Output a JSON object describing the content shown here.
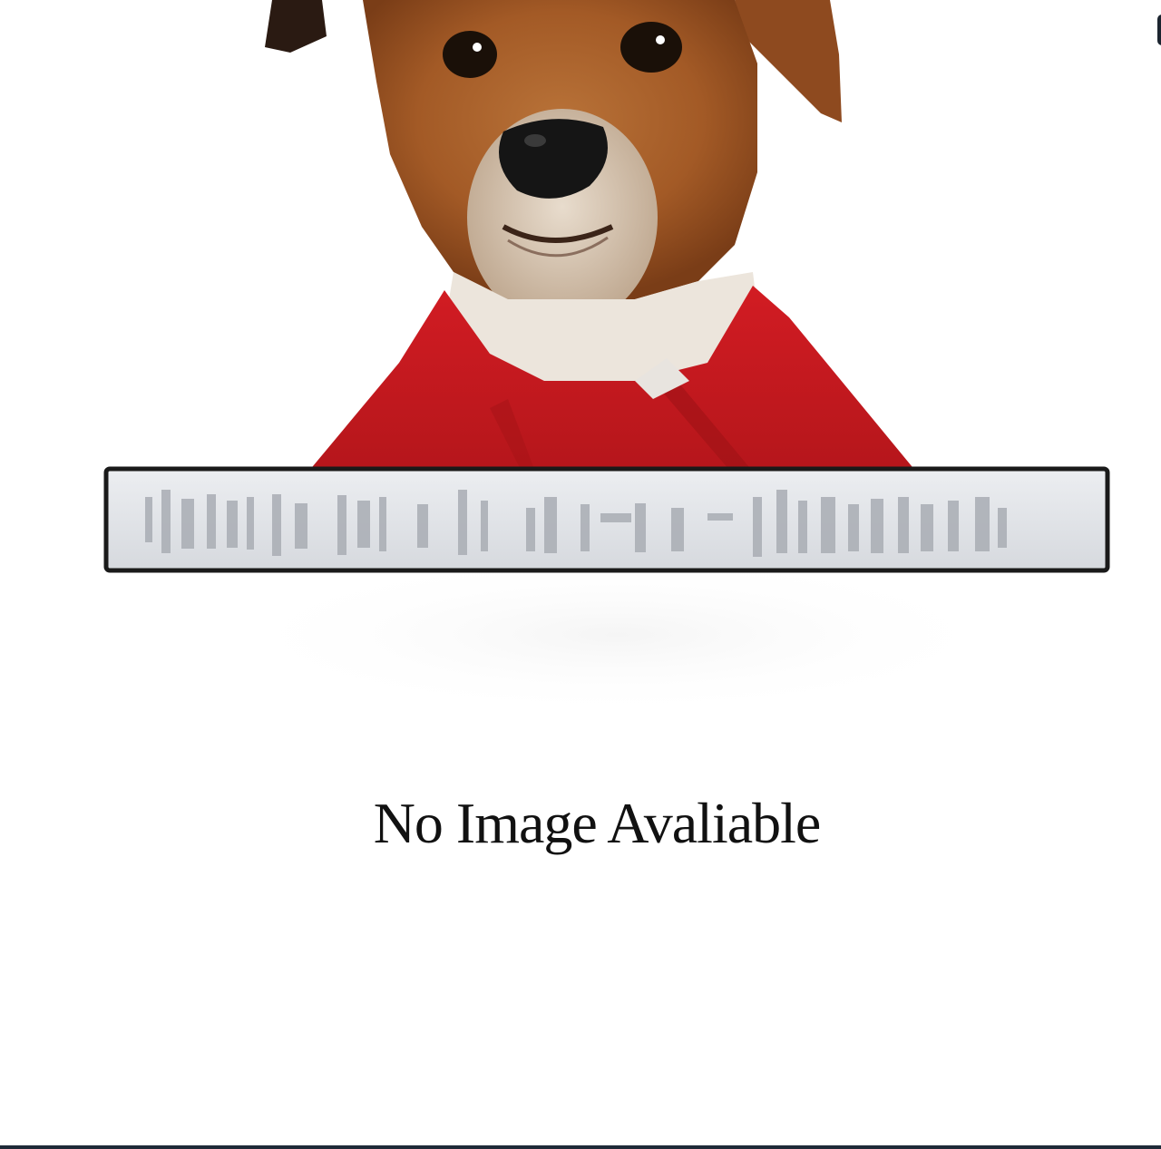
{
  "caption": {
    "text": "No Image Avaliable"
  },
  "placeholder": {
    "icon": "dog-with-bandana-icon",
    "banner_icon": "blurred-text-banner-icon"
  },
  "colors": {
    "background": "#ffffff",
    "caption_text": "#111111",
    "bandana": "#cc1a1f",
    "fur": "#a8602c",
    "banner_fill": "#e2e4e8",
    "banner_border": "#1a1a1a",
    "bottom_strip": "#1e2a38"
  }
}
